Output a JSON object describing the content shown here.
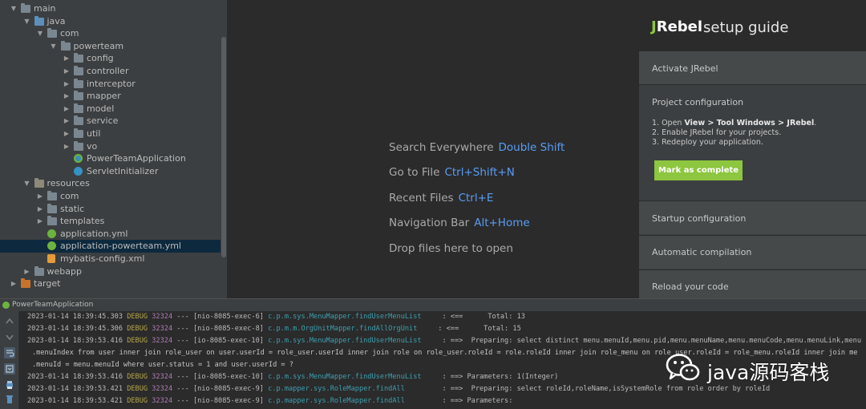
{
  "project_tree": {
    "items": [
      {
        "label": "main",
        "icon": "folder-icon",
        "arrow": "▼"
      },
      {
        "label": "java",
        "icon": "source-folder-icon",
        "arrow": "▼"
      },
      {
        "label": "com",
        "icon": "package-icon",
        "arrow": "▼"
      },
      {
        "label": "powerteam",
        "icon": "package-icon",
        "arrow": "▼"
      },
      {
        "label": "config",
        "icon": "package-icon",
        "arrow": "▶"
      },
      {
        "label": "controller",
        "icon": "package-icon",
        "arrow": "▶"
      },
      {
        "label": "interceptor",
        "icon": "package-icon",
        "arrow": "▶"
      },
      {
        "label": "mapper",
        "icon": "package-icon",
        "arrow": "▶"
      },
      {
        "label": "model",
        "icon": "package-icon",
        "arrow": "▶"
      },
      {
        "label": "service",
        "icon": "package-icon",
        "arrow": "▶"
      },
      {
        "label": "util",
        "icon": "package-icon",
        "arrow": "▶"
      },
      {
        "label": "vo",
        "icon": "package-icon",
        "arrow": "▶"
      },
      {
        "label": "PowerTeamApplication",
        "icon": "spring-boot-class-icon",
        "arrow": ""
      },
      {
        "label": "ServletInitializer",
        "icon": "java-class-icon",
        "arrow": ""
      },
      {
        "label": "resources",
        "icon": "resources-folder-icon",
        "arrow": "▼"
      },
      {
        "label": "com",
        "icon": "folder-icon",
        "arrow": "▶"
      },
      {
        "label": "static",
        "icon": "folder-icon",
        "arrow": "▶"
      },
      {
        "label": "templates",
        "icon": "folder-icon",
        "arrow": "▶"
      },
      {
        "label": "application.yml",
        "icon": "spring-config-icon",
        "arrow": ""
      },
      {
        "label": "application-powerteam.yml",
        "icon": "spring-config-icon",
        "arrow": "",
        "selected": true
      },
      {
        "label": "mybatis-config.xml",
        "icon": "xml-file-icon",
        "arrow": ""
      },
      {
        "label": "webapp",
        "icon": "folder-icon",
        "arrow": "▶"
      },
      {
        "label": "target",
        "icon": "excluded-folder-icon",
        "arrow": "▶"
      }
    ]
  },
  "editor": {
    "hints": [
      {
        "action": "Search Everywhere",
        "shortcut": "Double Shift"
      },
      {
        "action": "Go to File",
        "shortcut": "Ctrl+Shift+N"
      },
      {
        "action": "Recent Files",
        "shortcut": "Ctrl+E"
      },
      {
        "action": "Navigation Bar",
        "shortcut": "Alt+Home"
      },
      {
        "action": "Drop files here to open",
        "shortcut": ""
      }
    ]
  },
  "jrebel": {
    "logo": "JRebel",
    "title": "setup guide",
    "sections": {
      "activate": "Activate JRebel",
      "project_config": "Project configuration",
      "startup_config": "Startup configuration",
      "auto_compile": "Automatic compilation",
      "reload": "Reload your code"
    },
    "steps": {
      "step1_prefix": "1. Open ",
      "step1_view": "View",
      "step1_sep1": " > ",
      "step1_tool": "Tool Windows",
      "step1_sep2": " > ",
      "step1_jrebel": "JRebel",
      "step1_end": ".",
      "step2": "2. Enable JRebel for your projects.",
      "step3": "3. Redeploy your application."
    },
    "mark_button": "Mark as complete",
    "colors": {
      "accent": "#8dc63f"
    }
  },
  "run_window": {
    "title": "PowerTeamApplication"
  },
  "console": {
    "lines": [
      {
        "date": "2023-01-14 18:39:45.303",
        "level": "DEBUG",
        "pid": "32324",
        "thread": " --- [nio-8085-exec-6] ",
        "logger": "c.p.m.sys.MenuMapper.findUserMenuList    ",
        "msg": " : <==      Total: 13"
      },
      {
        "date": "2023-01-14 18:39:45.306",
        "level": "DEBUG",
        "pid": "32324",
        "thread": " --- [nio-8085-exec-8] ",
        "logger": "c.p.m.m.OrgUnitMapper.findAllOrgUnit    ",
        "msg": " : <==      Total: 15"
      },
      {
        "date": "2023-01-14 18:39:53.416",
        "level": "DEBUG",
        "pid": "32324",
        "thread": " --- [io-8085-exec-10] ",
        "logger": "c.p.m.sys.MenuMapper.findUserMenuList    ",
        "msg": " : ==>  Preparing: select distinct menu.menuId,menu.pid,menu.menuName,menu.menuCode,menu.menuLink,menu"
      },
      {
        "cont": ".menuIndex from user inner join role_user on user.userId = role_user.userId inner join role on role_user.roleId = role.roleId inner join role_menu on role_user.roleId = role_menu.roleId inner join me"
      },
      {
        "cont": ".menuId = menu.menuId where user.status = 1 and user.userId = ?"
      },
      {
        "date": "2023-01-14 18:39:53.416",
        "level": "DEBUG",
        "pid": "32324",
        "thread": " --- [io-8085-exec-10] ",
        "logger": "c.p.m.sys.MenuMapper.findUserMenuList    ",
        "msg": " : ==> Parameters: 1(Integer)"
      },
      {
        "date": "2023-01-14 18:39:53.421",
        "level": "DEBUG",
        "pid": "32324",
        "thread": " --- [nio-8085-exec-9] ",
        "logger": "c.p.mapper.sys.RoleMapper.findAll        ",
        "msg": " : ==>  Preparing: select roleId,roleName,isSystemRole from role order by roleId"
      },
      {
        "date": "2023-01-14 18:39:53.421",
        "level": "DEBUG",
        "pid": "32324",
        "thread": " --- [nio-8085-exec-9] ",
        "logger": "c.p.mapper.sys.RoleMapper.findAll        ",
        "msg": " : ==> Parameters:"
      }
    ]
  },
  "watermark": {
    "text": "java源码客栈"
  }
}
